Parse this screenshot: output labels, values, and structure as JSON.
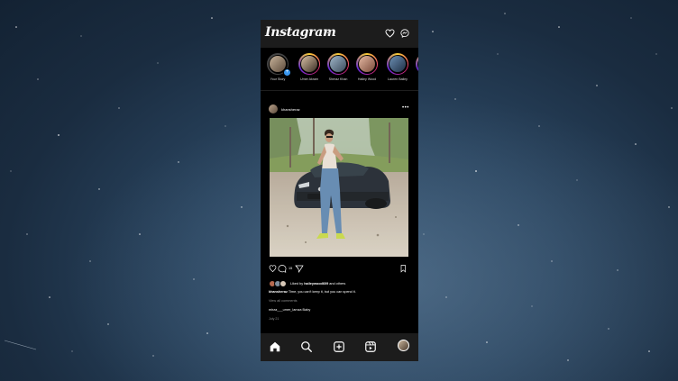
{
  "app": {
    "logo_text": "Instagram",
    "brand_colors": {
      "story_ring": [
        "#f9ce34",
        "#ee2a7b",
        "#6228d7"
      ],
      "background": "#000000",
      "bar": "#1c1c1c"
    }
  },
  "header": {
    "icons": [
      "chevron-down-icon",
      "heart-icon",
      "messenger-icon"
    ]
  },
  "stories": [
    {
      "name": "Your Story",
      "own": true
    },
    {
      "name": "Umer Akram",
      "own": false
    },
    {
      "name": "Sheraz Khan",
      "own": false
    },
    {
      "name": "Hailey Wood",
      "own": false
    },
    {
      "name": "Lauren Bailey",
      "own": false
    },
    {
      "name": "",
      "own": false
    }
  ],
  "post": {
    "username": "khansheraz",
    "comment_count": "15",
    "liked_by_prefix": "Liked by ",
    "liked_by_user": "haileywood609",
    "liked_by_suffix": " and others",
    "caption_user": "khansheraz",
    "caption_text": "Time, you can't keep it, but you can spend it.",
    "view_comments": "View all comments",
    "tags": "mirza___umer_lamza Baby",
    "date": "July 21"
  },
  "bottom_nav": {
    "icons": [
      "home-icon",
      "search-icon",
      "new-post-icon",
      "reels-icon",
      "profile-avatar"
    ]
  }
}
